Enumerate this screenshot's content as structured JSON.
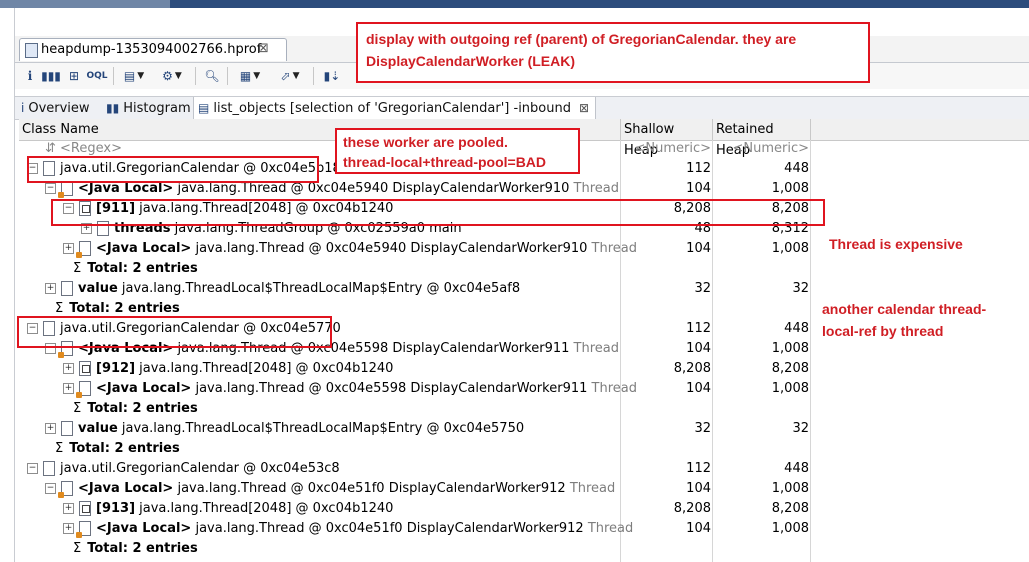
{
  "editor": {
    "tab_label": "heapdump-1353094002766.hprof",
    "close_glyph": "⊠"
  },
  "toolbar": {
    "icons": [
      "overview-icon",
      "histogram-icon",
      "dominator-tree-icon",
      "oql-icon",
      "thread-overview-icon",
      "query-browser-icon",
      "search-icon",
      "group-icon",
      "export-icon",
      "calculate-retained-icon"
    ]
  },
  "query_tabs": [
    {
      "label": "Overview",
      "icon": "i"
    },
    {
      "label": "Histogram",
      "icon": "▮▮"
    },
    {
      "label": "list_objects [selection of 'GregorianCalendar'] -inbound",
      "icon": "▤",
      "active": true
    }
  ],
  "columns": {
    "class_name": "Class Name",
    "shallow": "Shallow Heap",
    "retained": "Retained Heap"
  },
  "filter": {
    "regex": "<Regex>",
    "numeric1": "<Numeric>",
    "numeric2": "<Numeric>"
  },
  "rows": [
    {
      "indent": 0,
      "exp": "-",
      "icon": "obj",
      "pre": "",
      "text": "java.util.GregorianCalendar @ 0xc04e5b18",
      "suf": "",
      "sh": "112",
      "rh": "448"
    },
    {
      "indent": 1,
      "exp": "-",
      "icon": "thr",
      "pre": "<Java Local>",
      "text": " java.lang.Thread @ 0xc04e5940  DisplayCalendarWorker910",
      "suf": " Thread",
      "sh": "104",
      "rh": "1,008"
    },
    {
      "indent": 2,
      "exp": "-",
      "icon": "arr",
      "pre": "[911]",
      "text": " java.lang.Thread[2048] @ 0xc04b1240",
      "suf": "",
      "sh": "8,208",
      "rh": "8,208"
    },
    {
      "indent": 3,
      "exp": "+",
      "icon": "obj",
      "pre": "threads",
      "text": " java.lang.ThreadGroup @ 0xc02559a0  main",
      "suf": "",
      "sh": "48",
      "rh": "8,312"
    },
    {
      "indent": 2,
      "exp": "+",
      "icon": "thr",
      "pre": "<Java Local>",
      "text": " java.lang.Thread @ 0xc04e5940  DisplayCalendarWorker910",
      "suf": " Thread",
      "sh": "104",
      "rh": "1,008"
    },
    {
      "indent": 2,
      "exp": "",
      "icon": "sum",
      "pre": "Total: 2 entries",
      "text": "",
      "suf": "",
      "sh": "",
      "rh": ""
    },
    {
      "indent": 1,
      "exp": "+",
      "icon": "obj",
      "pre": "value",
      "text": " java.lang.ThreadLocal$ThreadLocalMap$Entry @ 0xc04e5af8",
      "suf": "",
      "sh": "32",
      "rh": "32"
    },
    {
      "indent": 1,
      "exp": "",
      "icon": "sum",
      "pre": "Total: 2 entries",
      "text": "",
      "suf": "",
      "sh": "",
      "rh": ""
    },
    {
      "indent": 0,
      "exp": "-",
      "icon": "obj",
      "pre": "",
      "text": "java.util.GregorianCalendar @ 0xc04e5770",
      "suf": "",
      "sh": "112",
      "rh": "448"
    },
    {
      "indent": 1,
      "exp": "-",
      "icon": "thr",
      "pre": "<Java Local>",
      "text": " java.lang.Thread @ 0xc04e5598  DisplayCalendarWorker911",
      "suf": " Thread",
      "sh": "104",
      "rh": "1,008"
    },
    {
      "indent": 2,
      "exp": "+",
      "icon": "arr",
      "pre": "[912]",
      "text": " java.lang.Thread[2048] @ 0xc04b1240",
      "suf": "",
      "sh": "8,208",
      "rh": "8,208"
    },
    {
      "indent": 2,
      "exp": "+",
      "icon": "thr",
      "pre": "<Java Local>",
      "text": " java.lang.Thread @ 0xc04e5598  DisplayCalendarWorker911",
      "suf": " Thread",
      "sh": "104",
      "rh": "1,008"
    },
    {
      "indent": 2,
      "exp": "",
      "icon": "sum",
      "pre": "Total: 2 entries",
      "text": "",
      "suf": "",
      "sh": "",
      "rh": ""
    },
    {
      "indent": 1,
      "exp": "+",
      "icon": "obj",
      "pre": "value",
      "text": " java.lang.ThreadLocal$ThreadLocalMap$Entry @ 0xc04e5750",
      "suf": "",
      "sh": "32",
      "rh": "32"
    },
    {
      "indent": 1,
      "exp": "",
      "icon": "sum",
      "pre": "Total: 2 entries",
      "text": "",
      "suf": "",
      "sh": "",
      "rh": ""
    },
    {
      "indent": 0,
      "exp": "-",
      "icon": "obj",
      "pre": "",
      "text": "java.util.GregorianCalendar @ 0xc04e53c8",
      "suf": "",
      "sh": "112",
      "rh": "448"
    },
    {
      "indent": 1,
      "exp": "-",
      "icon": "thr",
      "pre": "<Java Local>",
      "text": " java.lang.Thread @ 0xc04e51f0  DisplayCalendarWorker912",
      "suf": " Thread",
      "sh": "104",
      "rh": "1,008"
    },
    {
      "indent": 2,
      "exp": "+",
      "icon": "arr",
      "pre": "[913]",
      "text": " java.lang.Thread[2048] @ 0xc04b1240",
      "suf": "",
      "sh": "8,208",
      "rh": "8,208"
    },
    {
      "indent": 2,
      "exp": "+",
      "icon": "thr",
      "pre": "<Java Local>",
      "text": " java.lang.Thread @ 0xc04e51f0  DisplayCalendarWorker912",
      "suf": " Thread",
      "sh": "104",
      "rh": "1,008"
    },
    {
      "indent": 2,
      "exp": "",
      "icon": "sum",
      "pre": "Total: 2 entries",
      "text": "",
      "suf": "",
      "sh": "",
      "rh": ""
    }
  ],
  "annotations": {
    "top_line1": "display with outgoing ref (parent) of GregorianCalendar.  they are",
    "top_line2": "DisplayCalendarWorker (LEAK)",
    "pooled_line1": "these worker are pooled.",
    "pooled_line2": "thread-local+thread-pool=BAD",
    "expensive": "Thread is expensive",
    "another_line1": "another calendar thread-",
    "another_line2": "local-ref by thread"
  },
  "colors": {
    "annotation_red": "#e0141f",
    "title_strip": "#2c4c7c"
  }
}
